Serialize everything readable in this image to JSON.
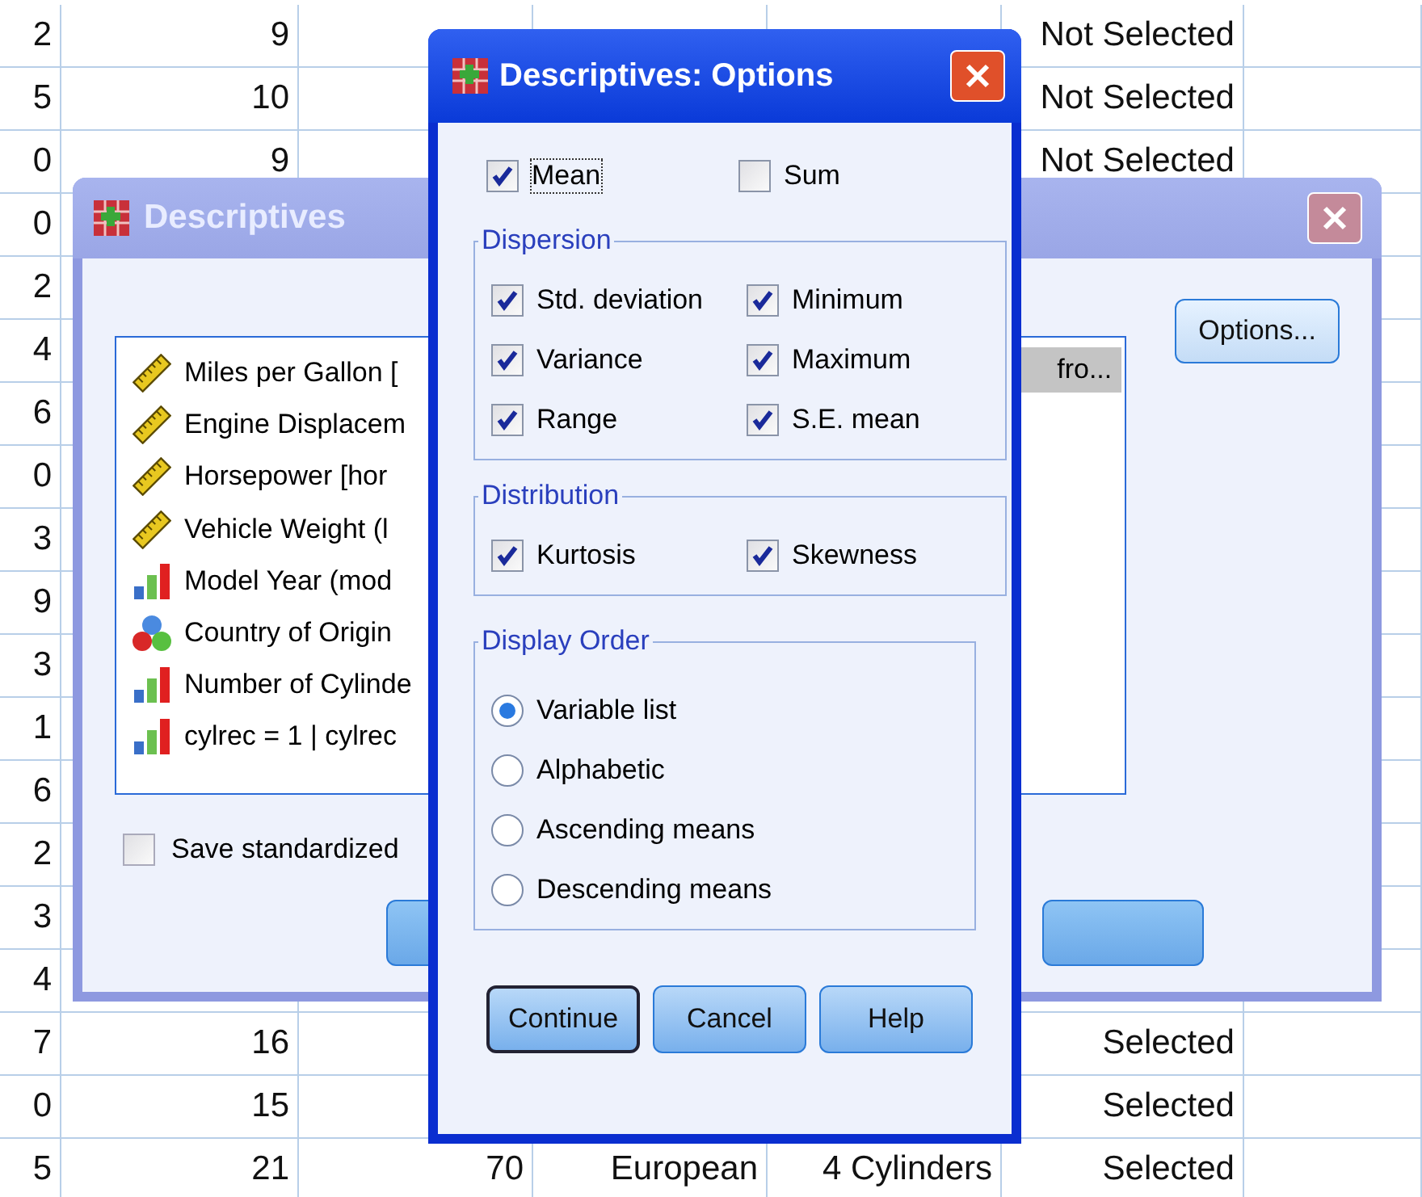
{
  "spreadsheet": {
    "rows": [
      {
        "cells": [
          "2",
          "9",
          null,
          null,
          null,
          "Not Selected"
        ]
      },
      {
        "cells": [
          "5",
          "10",
          null,
          null,
          null,
          "Not Selected"
        ]
      },
      {
        "cells": [
          "0",
          "9",
          null,
          null,
          null,
          "Not Selected"
        ]
      },
      {
        "cells": [
          "0",
          null,
          null,
          null,
          null,
          null
        ]
      },
      {
        "cells": [
          "2",
          null,
          null,
          null,
          null,
          null
        ]
      },
      {
        "cells": [
          "4",
          null,
          null,
          null,
          null,
          null
        ]
      },
      {
        "cells": [
          "6",
          null,
          null,
          null,
          null,
          null
        ]
      },
      {
        "cells": [
          "0",
          null,
          null,
          null,
          null,
          null
        ]
      },
      {
        "cells": [
          "3",
          null,
          null,
          null,
          null,
          null
        ]
      },
      {
        "cells": [
          "9",
          null,
          null,
          null,
          null,
          null
        ]
      },
      {
        "cells": [
          "3",
          null,
          null,
          null,
          null,
          null
        ]
      },
      {
        "cells": [
          "1",
          null,
          null,
          null,
          null,
          null
        ]
      },
      {
        "cells": [
          "6",
          null,
          null,
          null,
          null,
          null
        ]
      },
      {
        "cells": [
          "2",
          null,
          null,
          null,
          null,
          null
        ]
      },
      {
        "cells": [
          "3",
          null,
          null,
          null,
          null,
          null
        ]
      },
      {
        "cells": [
          "4",
          null,
          null,
          null,
          null,
          null
        ]
      },
      {
        "cells": [
          "7",
          "16",
          null,
          null,
          null,
          "Selected"
        ]
      },
      {
        "cells": [
          "0",
          "15",
          null,
          null,
          null,
          "Selected"
        ]
      },
      {
        "cells": [
          "5",
          "21",
          "70",
          "European",
          "4 Cylinders",
          "Selected"
        ]
      }
    ]
  },
  "descriptives_window": {
    "title": "Descriptives",
    "variables": [
      {
        "label": "Miles per Gallon [",
        "kind": "scale"
      },
      {
        "label": "Engine Displacem",
        "kind": "scale"
      },
      {
        "label": "Horsepower [hor",
        "kind": "scale"
      },
      {
        "label": "Vehicle Weight (l",
        "kind": "scale"
      },
      {
        "label": "Model Year (mod",
        "kind": "ordinal"
      },
      {
        "label": "Country of Origin",
        "kind": "nominal"
      },
      {
        "label": "Number of Cylinde",
        "kind": "ordinal"
      },
      {
        "label": "cylrec = 1 | cylrec",
        "kind": "ordinal"
      }
    ],
    "selected_variables": [
      {
        "label": "fro...",
        "selected": true
      }
    ],
    "options_button": "Options...",
    "save_checkbox": {
      "label": "Save standardized",
      "checked": false
    }
  },
  "options_dialog": {
    "title": "Descriptives: Options",
    "top_checks": [
      {
        "label": "Mean",
        "checked": true,
        "focused": true
      },
      {
        "label": "Sum",
        "checked": false,
        "focused": false
      }
    ],
    "groups": [
      {
        "title": "Dispersion",
        "kind": "checks",
        "items": [
          {
            "label": "Std. deviation",
            "checked": true
          },
          {
            "label": "Minimum",
            "checked": true
          },
          {
            "label": "Variance",
            "checked": true
          },
          {
            "label": "Maximum",
            "checked": true
          },
          {
            "label": "Range",
            "checked": true
          },
          {
            "label": "S.E. mean",
            "checked": true
          }
        ]
      },
      {
        "title": "Distribution",
        "kind": "checks",
        "items": [
          {
            "label": "Kurtosis",
            "checked": true
          },
          {
            "label": "Skewness",
            "checked": true
          }
        ]
      },
      {
        "title": "Display Order",
        "kind": "radios",
        "items": [
          {
            "label": "Variable list",
            "selected": true
          },
          {
            "label": "Alphabetic",
            "selected": false
          },
          {
            "label": "Ascending means",
            "selected": false
          },
          {
            "label": "Descending means",
            "selected": false
          }
        ]
      }
    ],
    "buttons": [
      {
        "label": "Continue",
        "default": true
      },
      {
        "label": "Cancel",
        "default": false
      },
      {
        "label": "Help",
        "default": false
      }
    ]
  }
}
